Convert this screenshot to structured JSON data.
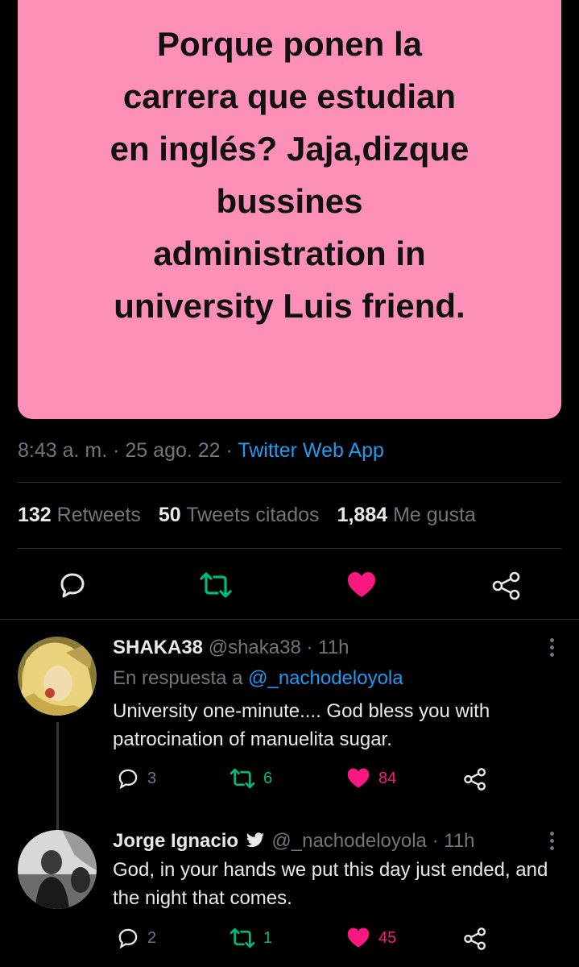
{
  "tweet": {
    "image_text": "Porque ponen la\ncarrera que estudian\nen inglés? Jaja,dizque\nbussines\nadministration in\nuniversity Luis friend.",
    "time": "8:43 a. m.",
    "date": "25 ago. 22",
    "separator": "·",
    "app": "Twitter Web App",
    "stats": {
      "retweets_count": "132",
      "retweets_label": "Retweets",
      "quotes_count": "50",
      "quotes_label": "Tweets citados",
      "likes_count": "1,884",
      "likes_label": "Me gusta"
    },
    "actions": [
      "reply-icon",
      "retweet-icon",
      "like-icon-filled",
      "share-icon"
    ]
  },
  "replies": [
    {
      "name": "SHAKA38",
      "handle": "@shaka38",
      "time": "11h",
      "in_reply_prefix": "En respuesta a",
      "in_reply_mention": "@_nachodeloyola",
      "text": "University one-minute.... God bless you with patrocination of manuelita sugar.",
      "replies": "3",
      "retweets": "6",
      "likes": "84"
    },
    {
      "name": "Jorge Ignacio",
      "handle": "@_nachodeloyola",
      "time": "11h",
      "text": "God, in your hands we put this day just ended, and the night that comes.",
      "replies": "2",
      "retweets": "1",
      "likes": "45"
    }
  ],
  "colors": {
    "card": "#fb8fb7",
    "link": "#1d9bf0",
    "retweet": "#00ba7c",
    "like": "#f91880",
    "muted": "#71767b"
  }
}
